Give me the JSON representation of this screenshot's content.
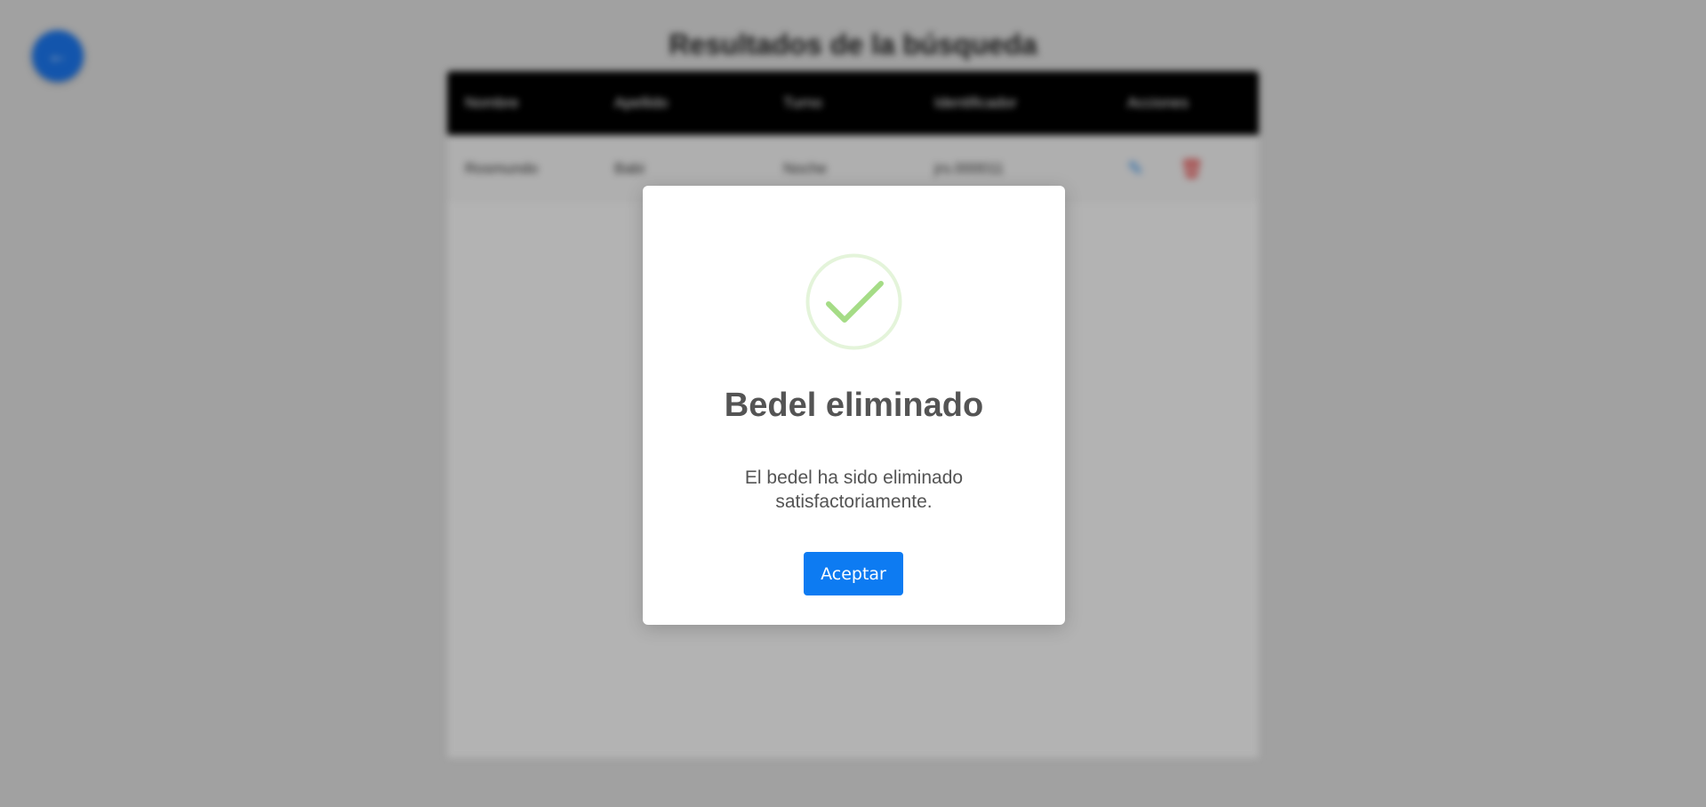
{
  "page": {
    "title": "Resultados de la búsqueda",
    "back_icon": "arrow-left-icon"
  },
  "table": {
    "headers": [
      "Nombre",
      "Apellido",
      "Turno",
      "Identificador",
      "Acciones"
    ],
    "rows": [
      {
        "nombre": "Rosmundo",
        "apellido": "Babi",
        "turno": "Noche",
        "identificador": "jrs.000011"
      }
    ]
  },
  "modal": {
    "icon": "check-circle-icon",
    "icon_color": "#a5dc86",
    "title": "Bedel eliminado",
    "text": "El bedel ha sido eliminado satisfactoriamente.",
    "button_label": "Aceptar",
    "button_color": "#0d7bf2"
  }
}
